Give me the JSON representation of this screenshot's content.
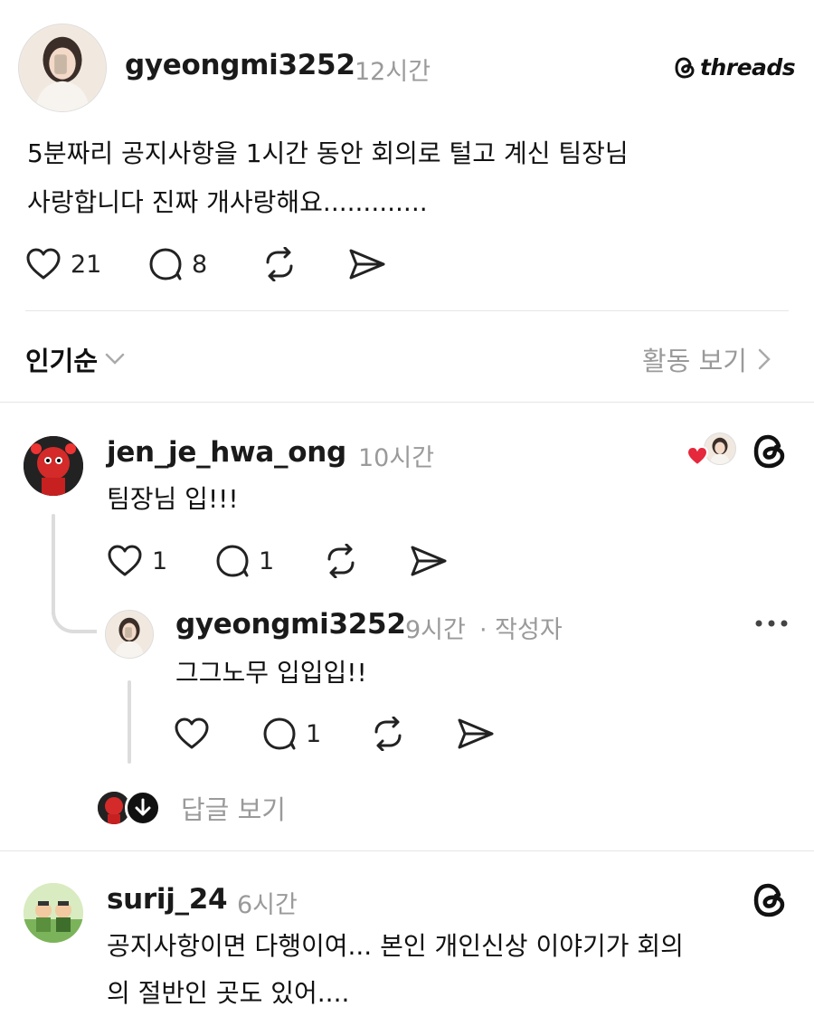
{
  "post": {
    "username": "gyeongmi3252",
    "time": "12시간",
    "brand": "threads",
    "text_line1": "5분짜리 공지사항을 1시간 동안 회의로 털고 계신 팀장님",
    "text_line2": "사랑합니다 진짜 개사랑해요.............",
    "likes": "21",
    "comments": "8"
  },
  "sort": {
    "label": "인기순",
    "activity": "활동 보기"
  },
  "reply1": {
    "username": "jen_je_hwa_ong",
    "time": "10시간",
    "text": "팀장님 입!!!",
    "likes": "1",
    "comments": "1"
  },
  "reply1_sub": {
    "username": "gyeongmi3252",
    "time": "9시간",
    "author_tag": "· 작성자",
    "text": "그그노무 입입입!!",
    "comments": "1"
  },
  "view_replies": "답글 보기",
  "reply2": {
    "username": "surij_24",
    "time": "6시간",
    "text_line1": "공지사항이면 다행이여... 본인 개인신상 이야기가 회의",
    "text_line2": "의 절반인 곳도 있어...."
  },
  "colors": {
    "heart_red": "#e5283b",
    "gray_text": "#9a9a9a"
  }
}
